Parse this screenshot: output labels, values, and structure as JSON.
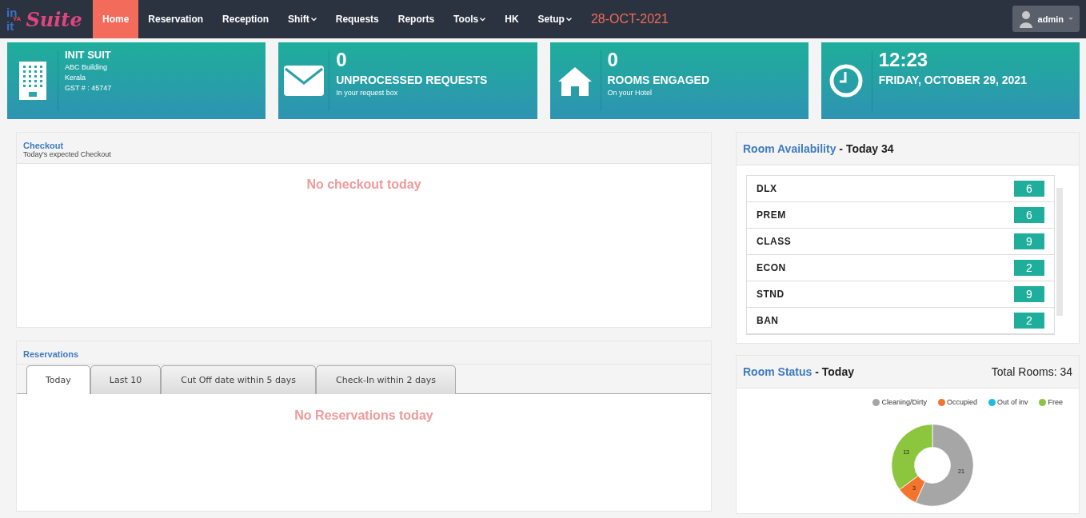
{
  "navbar": {
    "logo_top": "in",
    "logo_mid": "YA",
    "logo_bottom": "it",
    "logo_word": "Suite",
    "items": [
      {
        "label": "Home",
        "selected": true,
        "dropdown": false
      },
      {
        "label": "Reservation",
        "selected": false,
        "dropdown": false
      },
      {
        "label": "Reception",
        "selected": false,
        "dropdown": false
      },
      {
        "label": "Shift",
        "selected": false,
        "dropdown": true
      },
      {
        "label": "Requests",
        "selected": false,
        "dropdown": false
      },
      {
        "label": "Reports",
        "selected": false,
        "dropdown": false
      },
      {
        "label": "Tools",
        "selected": false,
        "dropdown": true
      },
      {
        "label": "HK",
        "selected": false,
        "dropdown": false
      },
      {
        "label": "Setup",
        "selected": false,
        "dropdown": true
      }
    ],
    "date": "28-OCT-2021",
    "user": "admin"
  },
  "cards": [
    {
      "kind": "building",
      "title": "INIT SUIT",
      "lines": [
        "ABC Building",
        "Kerala",
        "GST # : 45747"
      ]
    },
    {
      "kind": "mail",
      "value": "0",
      "title": "UNPROCESSED REQUESTS",
      "lines": [
        "In your request box"
      ]
    },
    {
      "kind": "home",
      "value": "0",
      "title": "ROOMS ENGAGED",
      "lines": [
        "On your Hotel"
      ]
    },
    {
      "kind": "clock",
      "value": "12:23",
      "title": "FRIDAY, OCTOBER 29, 2021"
    }
  ],
  "checkout": {
    "title": "Checkout",
    "subtitle": "Today's expected Checkout",
    "empty": "No checkout today"
  },
  "reservations": {
    "title": "Reservations",
    "tabs": [
      {
        "label": "Today",
        "selected": true
      },
      {
        "label": "Last 10",
        "selected": false
      },
      {
        "label": "Cut Off date within 5 days",
        "selected": false
      },
      {
        "label": "Check-In within 2 days",
        "selected": false
      }
    ],
    "empty": "No Reservations today"
  },
  "room_availability": {
    "title": "Room Availability",
    "suffix": "- Today 34",
    "rows": [
      {
        "name": "DLX",
        "count": "6"
      },
      {
        "name": "PREM",
        "count": "6"
      },
      {
        "name": "CLASS",
        "count": "9"
      },
      {
        "name": "ECON",
        "count": "2"
      },
      {
        "name": "STND",
        "count": "9"
      },
      {
        "name": "BAN",
        "count": "2"
      }
    ]
  },
  "room_status": {
    "title": "Room Status",
    "suffix": "- Today",
    "total": "Total Rooms: 34",
    "chart_data": {
      "type": "donut",
      "categories": [
        "Cleaning/Dirty",
        "Occupied",
        "Out of inv",
        "Free"
      ],
      "series": [
        {
          "values": [
            21,
            3,
            0,
            13
          ]
        }
      ],
      "colors": [
        "#a6a6a6",
        "#f4732d",
        "#1bbde0",
        "#8cc63f"
      ],
      "data_labels": true
    }
  }
}
